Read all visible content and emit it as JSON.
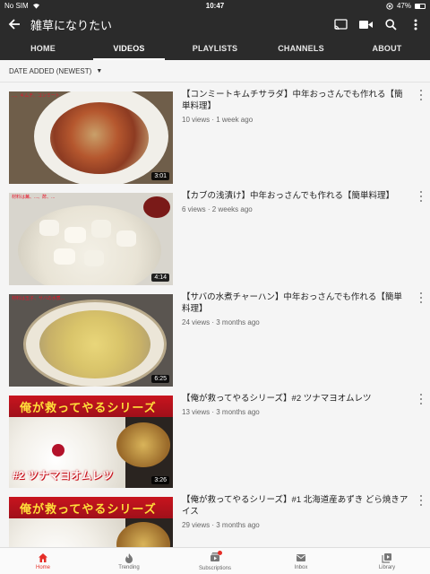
{
  "status_bar": {
    "carrier": "No SIM",
    "time": "10:47",
    "battery": "47%"
  },
  "app_bar": {
    "title": "雑草になりたい"
  },
  "tabs": [
    {
      "label": "HOME",
      "active": false
    },
    {
      "label": "VIDEOS",
      "active": true
    },
    {
      "label": "PLAYLISTS",
      "active": false
    },
    {
      "label": "CHANNELS",
      "active": false
    },
    {
      "label": "ABOUT",
      "active": false
    }
  ],
  "sort": {
    "label": "DATE ADDED (NEWEST)"
  },
  "videos": [
    {
      "title": "【コンミートキムチサラダ】中年おっさんでも作れる【簡単料理】",
      "views": "10 views",
      "age": "1 week ago",
      "duration": "3:01",
      "caption": "...、キムチ、コンミート"
    },
    {
      "title": "【カブの浅漬け】中年おっさんでも作れる【簡単料理】",
      "views": "6 views",
      "age": "2 weeks ago",
      "duration": "4:14",
      "caption": "材料は蕪、...、酢、..."
    },
    {
      "title": "【サバの水煮チャーハン】中年おっさんでも作れる【簡単料理】",
      "views": "24 views",
      "age": "3 months ago",
      "duration": "6:25",
      "caption": "材料は玉子、サバの水煮..."
    },
    {
      "title": "【俺が救ってやるシリーズ】#2 ツナマヨオムレツ",
      "views": "13 views",
      "age": "3 months ago",
      "duration": "3:26",
      "banner": "俺が救ってやるシリーズ",
      "label": "#2 ツナマヨオムレツ"
    },
    {
      "title": "【俺が救ってやるシリーズ】#1 北海道産あずき どら焼きアイス",
      "views": "29 views",
      "age": "3 months ago",
      "duration": "",
      "banner": "俺が救ってやるシリーズ"
    }
  ],
  "bottom_nav": [
    {
      "label": "Home",
      "active": true,
      "icon": "home-icon"
    },
    {
      "label": "Trending",
      "active": false,
      "icon": "flame-icon"
    },
    {
      "label": "Subscriptions",
      "active": false,
      "icon": "subscriptions-icon"
    },
    {
      "label": "Inbox",
      "active": false,
      "icon": "inbox-icon"
    },
    {
      "label": "Library",
      "active": false,
      "icon": "library-icon"
    }
  ],
  "colors": {
    "header": "#2b2b2b",
    "accent": "#e52d27",
    "background": "#f5f5f5"
  }
}
